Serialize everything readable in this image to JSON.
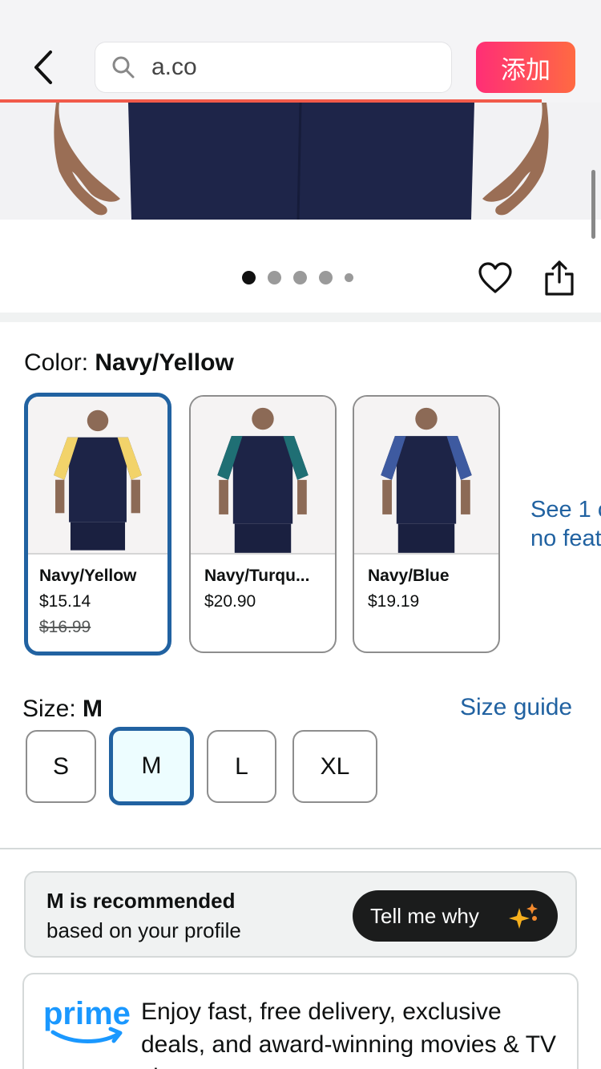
{
  "header": {
    "search_text": "a.co",
    "add_button_label": "添加"
  },
  "gallery": {
    "dot_count": 5,
    "active_dot": 0
  },
  "color": {
    "label": "Color:",
    "selected": "Navy/Yellow",
    "options": [
      {
        "name": "Navy/Yellow",
        "price": "$15.14",
        "list_price": "$16.99",
        "accent": "#f2d36a",
        "selected": true
      },
      {
        "name": "Navy/Turqu...",
        "price": "$20.90",
        "list_price": "",
        "accent": "#1f6f74",
        "selected": false
      },
      {
        "name": "Navy/Blue",
        "price": "$19.19",
        "list_price": "",
        "accent": "#3e5aa0",
        "selected": false
      }
    ],
    "see_more_line1": "See 1 c",
    "see_more_line2": "no feat"
  },
  "size": {
    "label": "Size:",
    "selected": "M",
    "guide_label": "Size guide",
    "options": [
      "S",
      "M",
      "L",
      "XL"
    ]
  },
  "recommendation": {
    "title": "M is recommended",
    "subtitle": "based on your profile",
    "button_label": "Tell me why"
  },
  "prime": {
    "logo_text": "prime",
    "text": "Enjoy fast, free delivery, exclusive deals, and award-winning movies & TV shows"
  },
  "colors": {
    "link_blue": "#2162a1",
    "shirt_navy": "#1d2447",
    "add_gradient_start": "#ff2e76",
    "add_gradient_end": "#ff6a42"
  }
}
